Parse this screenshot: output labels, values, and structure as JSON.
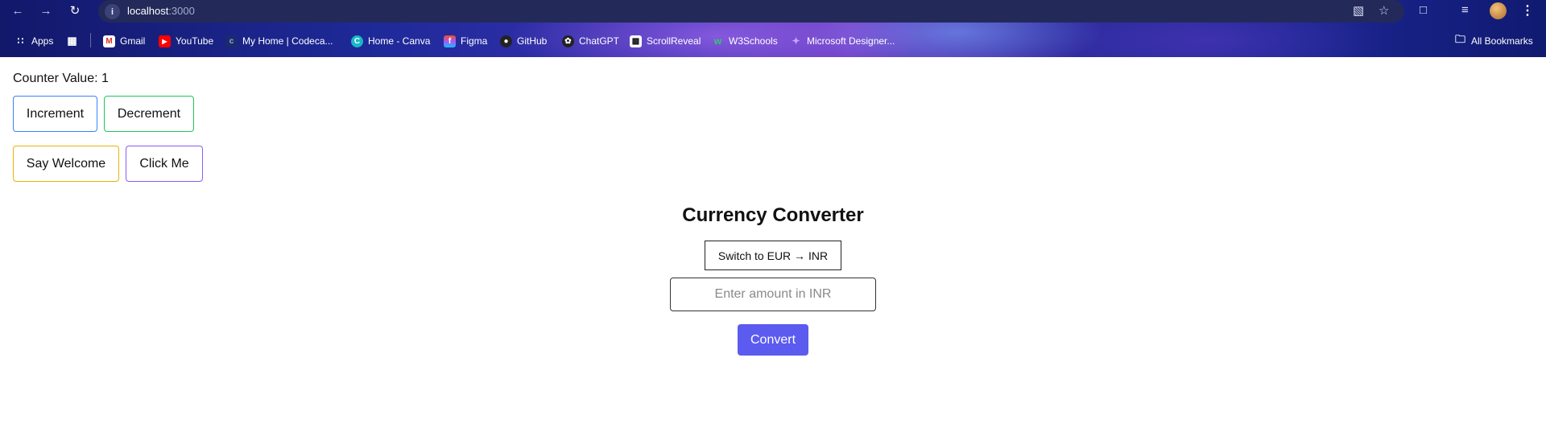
{
  "browser": {
    "url_host": "localhost",
    "url_port": ":3000",
    "bookmarks": [
      {
        "label": "Apps",
        "icon": "apps-grid-icon"
      },
      {
        "label": "Gmail",
        "icon": "gmail-icon"
      },
      {
        "label": "YouTube",
        "icon": "youtube-icon"
      },
      {
        "label": "My Home | Codeca...",
        "icon": "codecademy-icon"
      },
      {
        "label": "Home - Canva",
        "icon": "canva-icon"
      },
      {
        "label": "Figma",
        "icon": "figma-icon"
      },
      {
        "label": "GitHub",
        "icon": "github-icon"
      },
      {
        "label": "ChatGPT",
        "icon": "chatgpt-icon"
      },
      {
        "label": "ScrollReveal",
        "icon": "scrollreveal-icon"
      },
      {
        "label": "W3Schools",
        "icon": "w3schools-icon"
      },
      {
        "label": "Microsoft Designer...",
        "icon": "microsoft-designer-icon"
      }
    ],
    "all_bookmarks_label": "All Bookmarks"
  },
  "counter": {
    "label": "Counter Value: 1",
    "increment_label": "Increment",
    "decrement_label": "Decrement"
  },
  "actions": {
    "welcome_label": "Say Welcome",
    "click_label": "Click Me"
  },
  "converter": {
    "title": "Currency Converter",
    "switch_label": "Switch to EUR → INR",
    "input_placeholder": "Enter amount in INR",
    "input_value": "",
    "convert_label": "Convert"
  },
  "colors": {
    "increment_border": "#3b82f6",
    "decrement_border": "#22c55e",
    "welcome_border": "#eab308",
    "click_border": "#8b5cf6",
    "convert_bg": "#5b5bf0"
  }
}
